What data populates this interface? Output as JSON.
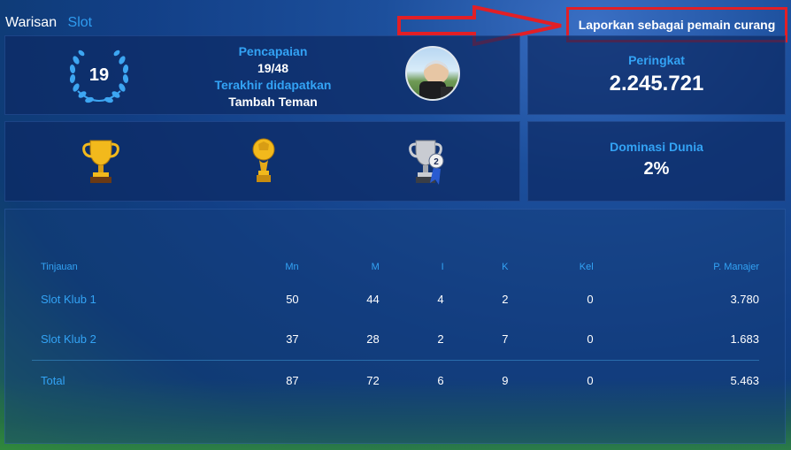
{
  "tabs": [
    {
      "label": "Warisan",
      "active": true
    },
    {
      "label": "Slot",
      "active": false
    }
  ],
  "report_button": "Laporkan sebagai pemain curang",
  "achievement": {
    "level": "19",
    "title": "Pencapaian",
    "progress": "19/48",
    "last_label": "Terakhir didapatkan",
    "last_value": "Tambah Teman"
  },
  "rank": {
    "label": "Peringkat",
    "value": "2.245.721"
  },
  "domination": {
    "label": "Dominasi Dunia",
    "value": "2%"
  },
  "trophies": [
    {
      "icon": "gold-cup-trophy-icon"
    },
    {
      "icon": "gold-ball-trophy-icon"
    },
    {
      "icon": "silver-cup-trophy-icon",
      "badge": "2"
    }
  ],
  "table": {
    "headers": [
      "Tinjauan",
      "Mn",
      "M",
      "I",
      "K",
      "Kel",
      "P. Manajer"
    ],
    "rows": [
      [
        "Slot Klub 1",
        "50",
        "44",
        "4",
        "2",
        "0",
        "3.780"
      ],
      [
        "Slot Klub 2",
        "37",
        "28",
        "2",
        "7",
        "0",
        "1.683"
      ]
    ],
    "total": [
      "Total",
      "87",
      "72",
      "6",
      "9",
      "0",
      "5.463"
    ]
  },
  "colors": {
    "accent": "#33a3f5",
    "highlight": "#e21f26",
    "gold": "#f2b91c",
    "silver": "#c9ccd2"
  }
}
